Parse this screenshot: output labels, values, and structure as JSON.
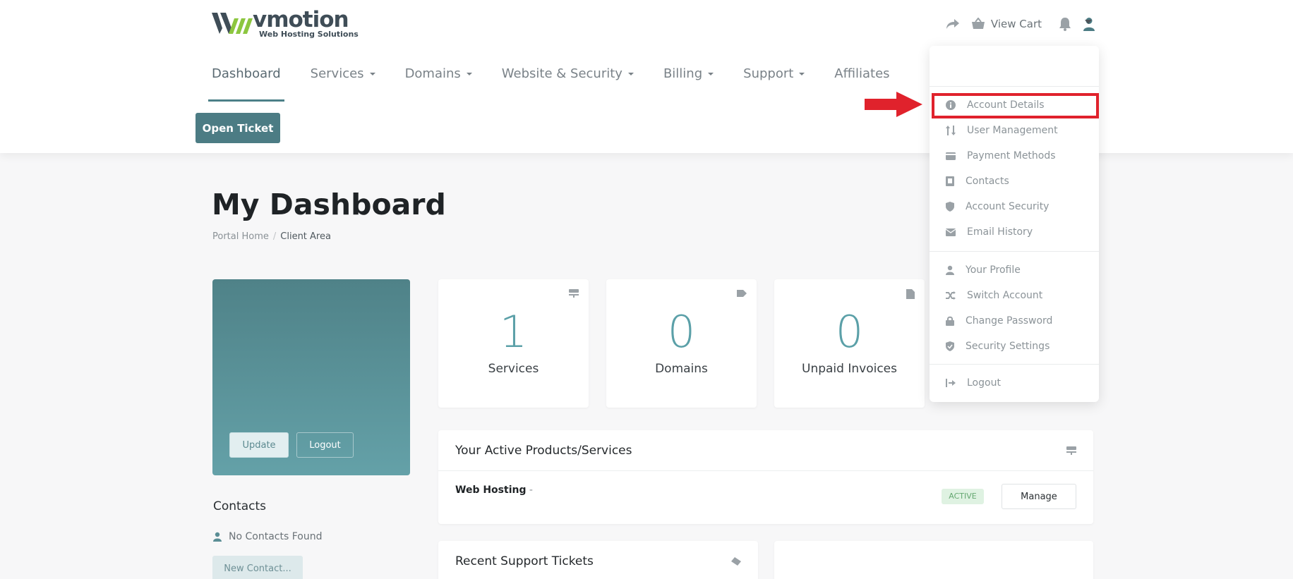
{
  "brand": {
    "name": "vmotion",
    "tagline": "Web Hosting Solutions",
    "accent": "#4c7c84",
    "logo_green": "#8cc63f"
  },
  "top_actions": {
    "view_cart": "View Cart"
  },
  "nav": {
    "items": [
      {
        "label": "Dashboard",
        "dropdown": false,
        "active": true
      },
      {
        "label": "Services",
        "dropdown": true
      },
      {
        "label": "Domains",
        "dropdown": true
      },
      {
        "label": "Website & Security",
        "dropdown": true
      },
      {
        "label": "Billing",
        "dropdown": true
      },
      {
        "label": "Support",
        "dropdown": true
      },
      {
        "label": "Affiliates",
        "dropdown": false
      }
    ]
  },
  "open_ticket": "Open Ticket",
  "page": {
    "title": "My Dashboard",
    "breadcrumb": [
      "Portal Home",
      "Client Area"
    ]
  },
  "profile_card": {
    "update": "Update",
    "logout": "Logout"
  },
  "contacts": {
    "title": "Contacts",
    "empty": "No Contacts Found",
    "new_contact": "New Contact..."
  },
  "stats": [
    {
      "value": "1",
      "label": "Services",
      "icon": "server-icon"
    },
    {
      "value": "0",
      "label": "Domains",
      "icon": "tag-icon"
    },
    {
      "value": "0",
      "label": "Unpaid Invoices",
      "icon": "file-icon"
    }
  ],
  "products_panel": {
    "title": "Your Active Products/Services",
    "service_name": "Web Hosting",
    "service_dash": " -",
    "status": "ACTIVE",
    "manage": "Manage"
  },
  "tickets_panel": {
    "title": "Recent Support Tickets"
  },
  "account_menu": {
    "items": [
      {
        "label": "Account Details",
        "icon": "info-circle-icon",
        "highlighted": true
      },
      {
        "label": "User Management",
        "icon": "sort-arrows-icon"
      },
      {
        "label": "Payment Methods",
        "icon": "wallet-icon"
      },
      {
        "label": "Contacts",
        "icon": "address-book-icon"
      },
      {
        "label": "Account Security",
        "icon": "shield-icon"
      },
      {
        "label": "Email History",
        "icon": "envelope-icon"
      },
      {
        "label": "Your Profile",
        "icon": "user-icon"
      },
      {
        "label": "Switch Account",
        "icon": "shuffle-icon"
      },
      {
        "label": "Change Password",
        "icon": "lock-icon"
      },
      {
        "label": "Security Settings",
        "icon": "shield-check-icon"
      },
      {
        "label": "Logout",
        "icon": "sign-out-icon"
      }
    ]
  }
}
